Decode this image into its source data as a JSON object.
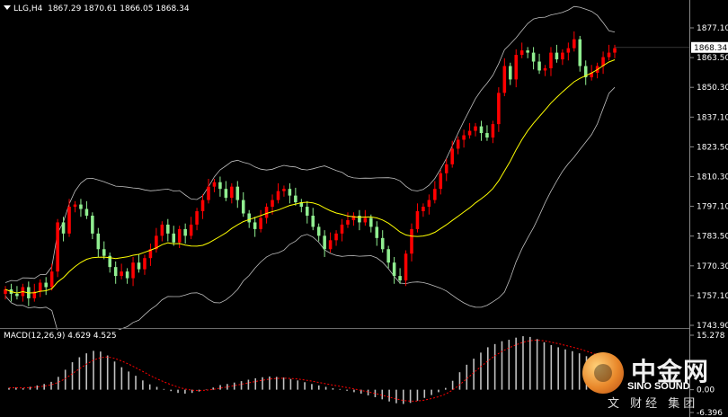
{
  "header": {
    "symbol": "LLG,H4",
    "ohlc": "1867.29 1870.61 1866.05 1868.34"
  },
  "macd_header": {
    "label": "MACD(12,26,9) 4.629 4.525"
  },
  "price_axis": {
    "ticks": [
      "1877.10",
      "1863.50",
      "1850.30",
      "1837.10",
      "1823.50",
      "1810.30",
      "1797.10",
      "1783.50",
      "1770.30",
      "1757.10",
      "1743.90"
    ],
    "current_price": "1868.34"
  },
  "macd_axis": {
    "ticks": [
      "15.278",
      "0.00",
      "-6.396"
    ]
  },
  "watermark": {
    "cn": "中金网",
    "en": "SINO SOUND",
    "sub": "文 财经 集团"
  },
  "colors": {
    "bull_candle": "#ff0000",
    "bear_candle": "#90ee90",
    "ma_line": "#ffff00",
    "bollinger": "#bfbfbf",
    "macd_hist": "#c0c0c0",
    "macd_signal": "#ff0000"
  },
  "chart_data": [
    {
      "type": "candlestick",
      "timeframe": "H4",
      "ylim": [
        1743.9,
        1877.1
      ],
      "close": [
        1760,
        1758,
        1757,
        1761,
        1756,
        1759,
        1763,
        1761,
        1768,
        1790,
        1785,
        1797,
        1798,
        1796,
        1793,
        1785,
        1778,
        1775,
        1770,
        1766,
        1768,
        1765,
        1772,
        1769,
        1774,
        1778,
        1784,
        1789,
        1785,
        1781,
        1787,
        1784,
        1789,
        1795,
        1800,
        1806,
        1808,
        1805,
        1801,
        1806,
        1800,
        1794,
        1790,
        1787,
        1792,
        1797,
        1800,
        1804,
        1805,
        1802,
        1799,
        1797,
        1793,
        1788,
        1784,
        1778,
        1782,
        1785,
        1789,
        1791,
        1793,
        1790,
        1792,
        1788,
        1783,
        1778,
        1772,
        1766,
        1764,
        1776,
        1787,
        1795,
        1797,
        1800,
        1805,
        1812,
        1816,
        1823,
        1827,
        1829,
        1831,
        1833,
        1830,
        1828,
        1834,
        1848,
        1860,
        1854,
        1865,
        1867,
        1866,
        1862,
        1858,
        1859,
        1866,
        1863,
        1866,
        1868,
        1872,
        1860,
        1855,
        1857,
        1860,
        1864,
        1866,
        1868
      ]
    },
    {
      "type": "bar",
      "title": "MACD(12,26,9)",
      "ylim": [
        -6.396,
        15.278
      ],
      "values": [
        0.5,
        0.6,
        0.4,
        0.8,
        1.2,
        1.6,
        2.2,
        3.6,
        5.6,
        7.7,
        9.1,
        10.2,
        10.9,
        10.7,
        9.6,
        7.9,
        6.3,
        5.1,
        3.9,
        2.6,
        1.5,
        0.8,
        0.2,
        -0.4,
        -0.9,
        -1.1,
        -0.9,
        -0.5,
        0.1,
        0.6,
        1.3,
        1.6,
        2.0,
        2.4,
        2.8,
        3.2,
        3.5,
        3.7,
        3.6,
        3.4,
        3.0,
        2.6,
        2.1,
        1.6,
        1.2,
        0.8,
        0.4,
        0.2,
        -0.3,
        -0.7,
        -1.1,
        -1.6,
        -2.1,
        -2.7,
        -3.3,
        -3.8,
        -4.0,
        -3.7,
        -3.1,
        -2.3,
        -1.5,
        -0.7,
        0.5,
        2.5,
        4.9,
        7.0,
        8.7,
        10.4,
        11.9,
        12.8,
        13.6,
        14.0,
        14.6,
        15.0,
        14.8,
        14.2,
        13.3,
        12.5,
        11.9,
        11.3,
        10.8,
        10.2,
        9.4,
        8.5,
        7.6,
        6.5
      ]
    }
  ]
}
